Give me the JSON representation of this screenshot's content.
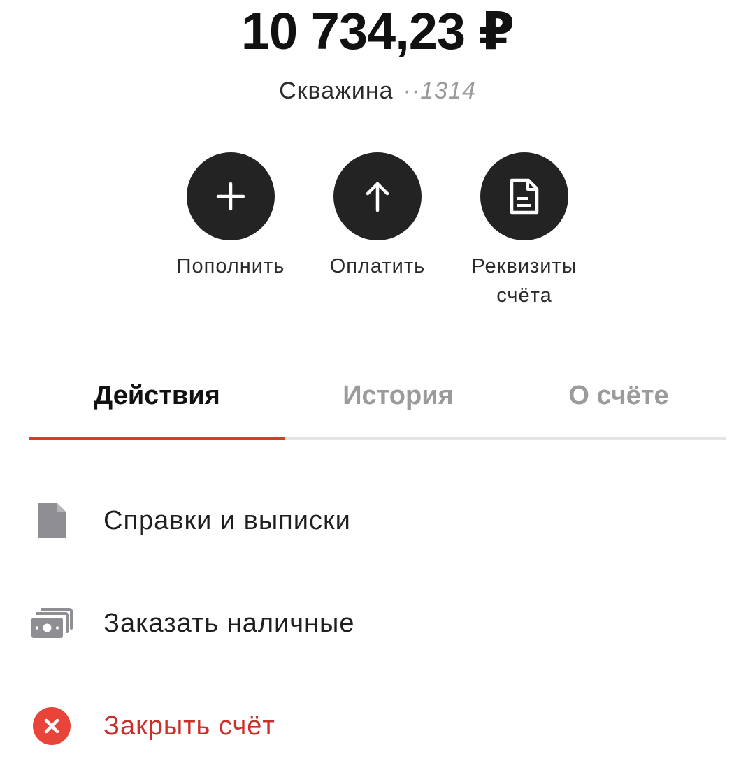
{
  "balance": {
    "amount": "10 734,23 ₽"
  },
  "account": {
    "name": "Скважина",
    "mask": "··1314"
  },
  "actions": [
    {
      "label": "Пополнить",
      "icon": "plus-icon"
    },
    {
      "label": "Оплатить",
      "icon": "arrow-up-icon"
    },
    {
      "label": "Реквизиты счёта",
      "icon": "document-icon"
    }
  ],
  "tabs": [
    {
      "label": "Действия",
      "active": true
    },
    {
      "label": "История",
      "active": false
    },
    {
      "label": "О счёте",
      "active": false
    }
  ],
  "menu": [
    {
      "label": "Справки и выписки",
      "icon": "document-icon"
    },
    {
      "label": "Заказать наличные",
      "icon": "cash-icon"
    },
    {
      "label": "Закрыть счёт",
      "icon": "close-circle-icon"
    }
  ],
  "colors": {
    "accent": "#e2362c",
    "action_circle": "#232323",
    "inactive_text": "#9b9b9b",
    "danger_text": "#c9302c",
    "icon_gray": "#8e8e93"
  }
}
